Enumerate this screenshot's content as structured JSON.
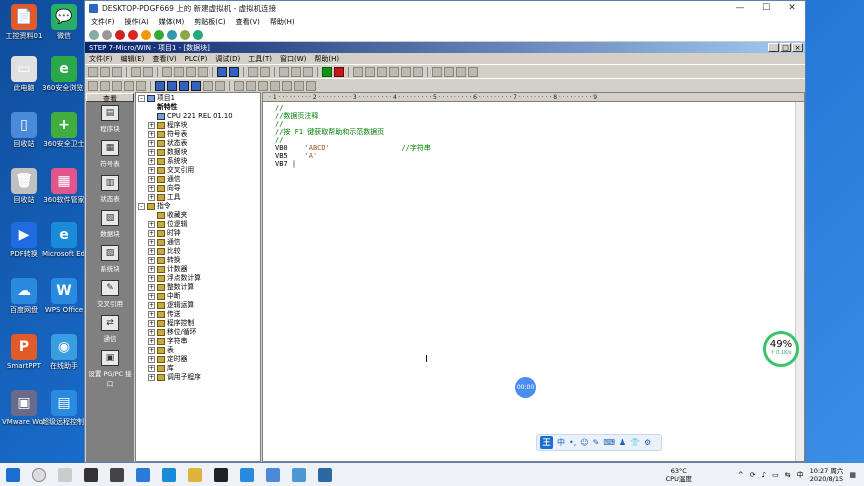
{
  "desktop": {
    "icons": [
      {
        "label": "工控资料01",
        "color": "#e25a2a",
        "glyph": "📄"
      },
      {
        "label": "微信",
        "color": "#2aae67",
        "glyph": "💬"
      },
      {
        "label": "此电脑",
        "color": "#e0e0e0",
        "glyph": "▭"
      },
      {
        "label": "360安全浏览器",
        "color": "#2aa84a",
        "glyph": "e"
      },
      {
        "label": "回收站",
        "color": "#4a8ad8",
        "glyph": "▯"
      },
      {
        "label": "360安全卫士",
        "color": "#3fae3f",
        "glyph": "+"
      },
      {
        "label": "回收站",
        "color": "#c0c0c0",
        "glyph": "🗑"
      },
      {
        "label": "360软件管家",
        "color": "#e0568c",
        "glyph": "▦"
      },
      {
        "label": "PDF转换",
        "color": "#1f6be0",
        "glyph": "▶"
      },
      {
        "label": "Microsoft Edge",
        "color": "#1a8bd8",
        "glyph": "e"
      },
      {
        "label": "百度网盘",
        "color": "#2a8ae0",
        "glyph": "☁"
      },
      {
        "label": "WPS Office",
        "color": "#2a8ae0",
        "glyph": "W"
      },
      {
        "label": "SmartPPT",
        "color": "#e05a2a",
        "glyph": "P"
      },
      {
        "label": "在线助手",
        "color": "#3a9de0",
        "glyph": "◉"
      },
      {
        "label": "VMware Workstati...",
        "color": "#6a6a8a",
        "glyph": "▣"
      },
      {
        "label": "超级远程控制客户端",
        "color": "#2a8ae0",
        "glyph": "▤"
      }
    ]
  },
  "vm_window": {
    "title": "DESKTOP-PDGF669 上的 新建虚拟机 - 虚拟机连接",
    "controls": [
      "—",
      "☐",
      "✕"
    ],
    "menu": [
      "文件(F)",
      "操作(A)",
      "媒体(M)",
      "剪贴板(C)",
      "查看(V)",
      "帮助(H)"
    ]
  },
  "step7": {
    "title": "STEP 7-Micro/WIN - 项目1 - [数据块]",
    "menu": [
      "文件(F)",
      "编辑(E)",
      "查看(V)",
      "PLC(P)",
      "调试(D)",
      "工具(T)",
      "窗口(W)",
      "帮助(H)"
    ],
    "nav_header": "查看",
    "nav_items": [
      "程序块",
      "符号表",
      "状态表",
      "数据块",
      "系统块",
      "交叉引用",
      "通信",
      "设置 PG/PC 接口"
    ],
    "tree": [
      {
        "label": "项目1",
        "level": 0,
        "exp": "-",
        "bold": false,
        "icon": "blue"
      },
      {
        "label": "新特性",
        "level": 1,
        "exp": "",
        "bold": true,
        "icon": "none"
      },
      {
        "label": "CPU 221 REL 01.10",
        "level": 1,
        "exp": "",
        "bold": false,
        "icon": "blue"
      },
      {
        "label": "程序块",
        "level": 1,
        "exp": "+",
        "bold": false,
        "icon": "y"
      },
      {
        "label": "符号表",
        "level": 1,
        "exp": "+",
        "bold": false,
        "icon": "y"
      },
      {
        "label": "状态表",
        "level": 1,
        "exp": "+",
        "bold": false,
        "icon": "y"
      },
      {
        "label": "数据块",
        "level": 1,
        "exp": "+",
        "bold": false,
        "icon": "y"
      },
      {
        "label": "系统块",
        "level": 1,
        "exp": "+",
        "bold": false,
        "icon": "y"
      },
      {
        "label": "交叉引用",
        "level": 1,
        "exp": "+",
        "bold": false,
        "icon": "y"
      },
      {
        "label": "通信",
        "level": 1,
        "exp": "+",
        "bold": false,
        "icon": "y"
      },
      {
        "label": "向导",
        "level": 1,
        "exp": "+",
        "bold": false,
        "icon": "y"
      },
      {
        "label": "工具",
        "level": 1,
        "exp": "+",
        "bold": false,
        "icon": "y"
      },
      {
        "label": "指令",
        "level": 0,
        "exp": "-",
        "bold": false,
        "icon": "y"
      },
      {
        "label": "收藏夹",
        "level": 1,
        "exp": "",
        "bold": false,
        "icon": "y"
      },
      {
        "label": "位逻辑",
        "level": 1,
        "exp": "+",
        "bold": false,
        "icon": "y"
      },
      {
        "label": "时钟",
        "level": 1,
        "exp": "+",
        "bold": false,
        "icon": "y"
      },
      {
        "label": "通信",
        "level": 1,
        "exp": "+",
        "bold": false,
        "icon": "y"
      },
      {
        "label": "比较",
        "level": 1,
        "exp": "+",
        "bold": false,
        "icon": "y"
      },
      {
        "label": "转换",
        "level": 1,
        "exp": "+",
        "bold": false,
        "icon": "y"
      },
      {
        "label": "计数器",
        "level": 1,
        "exp": "+",
        "bold": false,
        "icon": "y"
      },
      {
        "label": "浮点数计算",
        "level": 1,
        "exp": "+",
        "bold": false,
        "icon": "y"
      },
      {
        "label": "整数计算",
        "level": 1,
        "exp": "+",
        "bold": false,
        "icon": "y"
      },
      {
        "label": "中断",
        "level": 1,
        "exp": "+",
        "bold": false,
        "icon": "y"
      },
      {
        "label": "逻辑运算",
        "level": 1,
        "exp": "+",
        "bold": false,
        "icon": "y"
      },
      {
        "label": "传送",
        "level": 1,
        "exp": "+",
        "bold": false,
        "icon": "y"
      },
      {
        "label": "程序控制",
        "level": 1,
        "exp": "+",
        "bold": false,
        "icon": "y"
      },
      {
        "label": "移位/循环",
        "level": 1,
        "exp": "+",
        "bold": false,
        "icon": "y"
      },
      {
        "label": "字符串",
        "level": 1,
        "exp": "+",
        "bold": false,
        "icon": "y"
      },
      {
        "label": "表",
        "level": 1,
        "exp": "+",
        "bold": false,
        "icon": "y"
      },
      {
        "label": "定时器",
        "level": 1,
        "exp": "+",
        "bold": false,
        "icon": "y"
      },
      {
        "label": "库",
        "level": 1,
        "exp": "+",
        "bold": false,
        "icon": "y"
      },
      {
        "label": "调用子程序",
        "level": 1,
        "exp": "+",
        "bold": false,
        "icon": "y"
      }
    ],
    "ruler": "· 1 · · · · · · · · · 2 · · · · · · · · · 3 · · · · · · · · · 4 · · · · · · · · · 5 · · · · · · · · · 6 · · · · · · · · · 7 · · · · · · · · · 8 · · · · · · · · · 9",
    "code_lines": [
      {
        "text": "//",
        "cls": "cmt"
      },
      {
        "text": "//数据页注释",
        "cls": "cmt"
      },
      {
        "text": "//",
        "cls": "cmt"
      },
      {
        "text": "//按 F1 键获取帮助和示范数据页",
        "cls": "cmt"
      },
      {
        "text": "//",
        "cls": "cmt"
      },
      {
        "text": "VB0    'ABCD'                 //字符串",
        "cls": "mix"
      },
      {
        "text": "VB5    'A'",
        "cls": "mix"
      },
      {
        "text": "VB7 |",
        "cls": "plain"
      }
    ]
  },
  "overlays": {
    "perf_percent": "49%",
    "perf_speed": "↑ 0.1K/s",
    "record_time": "00:00",
    "ime": [
      "中",
      "•,",
      "☺",
      "✎",
      "⌨",
      "♟",
      "👕",
      "⚙"
    ],
    "ime_logo": "王"
  },
  "taskbar": {
    "cpu_temp": "63°C",
    "cpu_label": "CPU温度",
    "time": "10:27 周六",
    "date": "2020/8/15",
    "tray_icons": [
      "^",
      "⟳",
      "♪",
      "▭",
      "⇆",
      "中",
      "▦"
    ]
  }
}
